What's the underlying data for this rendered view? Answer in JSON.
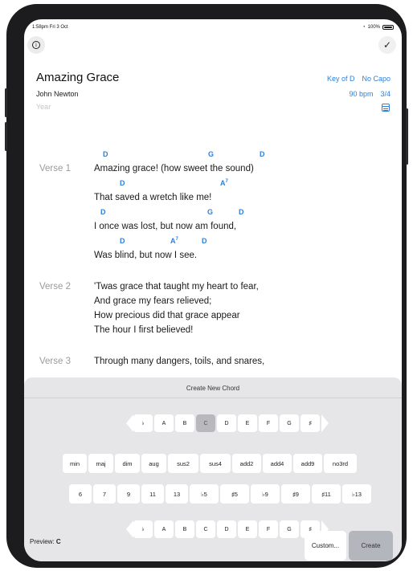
{
  "status_bar": {
    "time": "1:58pm  Fri 3 Oct",
    "battery": "100%"
  },
  "toolbar": {
    "info_icon": "info-icon",
    "done_icon": "checkmark-icon",
    "done_symbol": "✓"
  },
  "song": {
    "title": "Amazing Grace",
    "artist": "John Newton",
    "year_placeholder": "Year",
    "key": "Key of D",
    "capo": "No Capo",
    "tempo": "90 bpm",
    "time_signature": "3/4"
  },
  "lyrics": {
    "verse1_label": "Verse 1",
    "verse1_lines": [
      "Amazing grace! (how sweet the sound)",
      "That saved a wretch like me!",
      "I once was lost, but now am found,",
      "Was blind, but now I see."
    ],
    "verse1_chords": {
      "line1": [
        "D",
        "G",
        "D"
      ],
      "line2": [
        "D",
        "A",
        "7"
      ],
      "line3": [
        "D",
        "G",
        "D"
      ],
      "line4": [
        "D",
        "A",
        "7",
        "D"
      ]
    },
    "verse2_label": "Verse 2",
    "verse2_lines": [
      "'Twas grace that taught my heart to fear,",
      "And grace my fears relieved;",
      "How precious did that grace appear",
      "The hour I first believed!"
    ],
    "verse3_label": "Verse 3",
    "verse3_line1": "Through many dangers, toils, and snares,"
  },
  "chord_builder": {
    "title": "Create New Chord",
    "root_notes": [
      "♭",
      "A",
      "B",
      "C",
      "D",
      "E",
      "F",
      "G",
      "♯"
    ],
    "root_selected": "C",
    "qualities": [
      "min",
      "maj",
      "dim",
      "aug",
      "sus2",
      "sus4",
      "add2",
      "add4",
      "add9",
      "no3rd"
    ],
    "extensions": [
      "6",
      "7",
      "9",
      "11",
      "13",
      "♭5",
      "♯5",
      "♭9",
      "♯9",
      "♯11",
      "♭13"
    ],
    "bass_notes": [
      "♭",
      "A",
      "B",
      "C",
      "D",
      "E",
      "F",
      "G",
      "♯"
    ],
    "preview_label": "Preview:",
    "preview_value": "C",
    "custom_label": "Custom...",
    "create_label": "Create"
  }
}
